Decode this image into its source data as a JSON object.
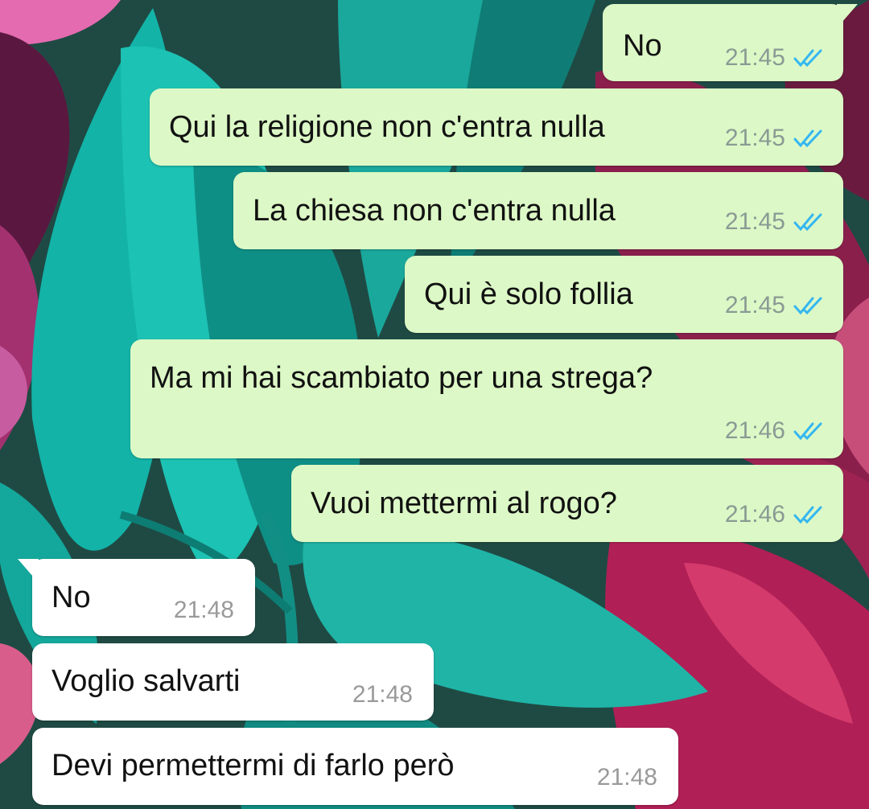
{
  "colors": {
    "outgoing_bubble": "#dcf8c6",
    "incoming_bubble": "#ffffff",
    "read_ticks": "#34b7f1",
    "timestamp": "#8a9a94"
  },
  "icons": {
    "read_receipt": "double-check-icon"
  },
  "messages": [
    {
      "direction": "outgoing",
      "text": "No",
      "time": "21:45",
      "status": "read"
    },
    {
      "direction": "outgoing",
      "text": "Qui la religione non c'entra nulla",
      "time": "21:45",
      "status": "read"
    },
    {
      "direction": "outgoing",
      "text": "La chiesa non c'entra nulla",
      "time": "21:45",
      "status": "read"
    },
    {
      "direction": "outgoing",
      "text": "Qui è solo follia",
      "time": "21:45",
      "status": "read"
    },
    {
      "direction": "outgoing",
      "text": "Ma mi hai scambiato per una strega?",
      "time": "21:46",
      "status": "read"
    },
    {
      "direction": "outgoing",
      "text": "Vuoi mettermi al rogo?",
      "time": "21:46",
      "status": "read"
    },
    {
      "direction": "incoming",
      "text": "No",
      "time": "21:48"
    },
    {
      "direction": "incoming",
      "text": "Voglio salvarti",
      "time": "21:48"
    },
    {
      "direction": "incoming",
      "text": "Devi permettermi di farlo però",
      "time": "21:48"
    }
  ]
}
